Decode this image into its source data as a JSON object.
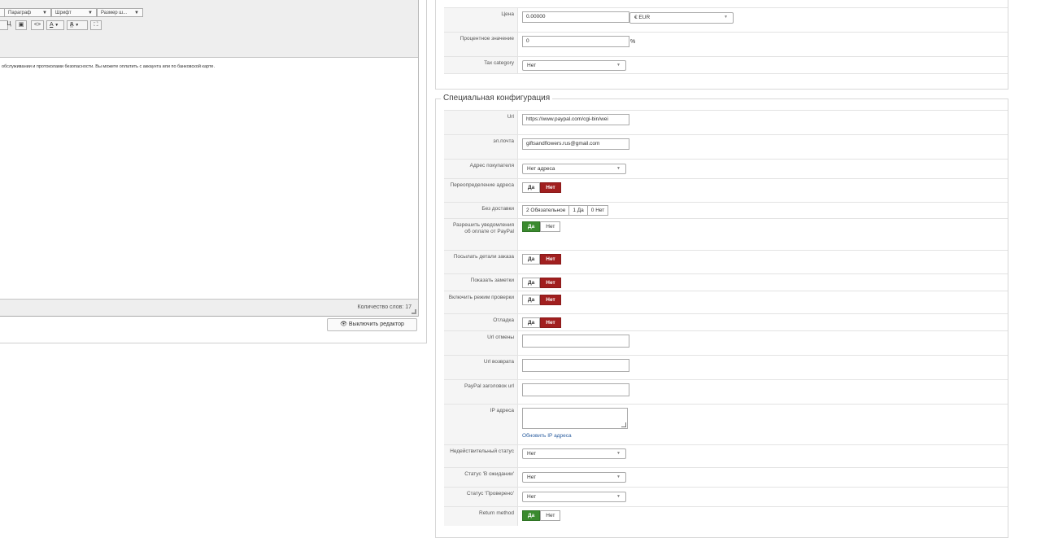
{
  "editor": {
    "toolbar_top_text": "...",
    "format_select": "Параграф",
    "font_select": "Шрифт",
    "size_select": "Размер ш...",
    "buttons": [
      "I",
      "Ц",
      "▣",
      "<>",
      "A",
      "A",
      "⛶"
    ],
    "content": "обслуживании и протоколами безопасности. Вы можете оплатить с аккаунта или по банковской карте.",
    "word_count": "Количество слов: 17",
    "toggle_editor_label": "👁 Выключить редактор"
  },
  "pricing": {
    "price_label": "Цена",
    "price_value": "0.00000",
    "currency_value": "€ EUR",
    "percent_label": "Процентное значение",
    "percent_value": "0",
    "percent_suffix": "%",
    "tax_label": "Tax category",
    "tax_value": "Нет"
  },
  "special": {
    "legend": "Специальная конфигурация",
    "url_label": "Url",
    "url_value": "https://www.paypal.com/cgi-bin/wei",
    "email_label": "эл.почта",
    "email_value": "giftsandflowers.rus@gmail.com",
    "buyer_address_label": "Адрес покупателя",
    "buyer_address_value": "Нет адреса",
    "override_address_label": "Переопределение адреса",
    "no_shipping_label": "Без доставки",
    "no_shipping_options": [
      "2 Обязательное",
      "1 Да",
      "0 Нет"
    ],
    "ipn_label": "Разрешить уведомления об оплате от PayPal",
    "send_details_label": "Посылать детали заказа",
    "show_notes_label": "Показать заметки",
    "test_mode_label": "Включить режим проверки",
    "debug_label": "Отладка",
    "cancel_url_label": "Url отмены",
    "return_url_label": "Url возврата",
    "header_url_label": "PayPal заголовок url",
    "ip_label": "IP адреса",
    "refresh_ip_link": "Обновить IP адреса",
    "invalid_status_label": "Недействительный статус",
    "invalid_status_value": "Нет",
    "pending_status_label": "Статус 'В ожидании'",
    "pending_status_value": "Нет",
    "verified_status_label": "Статус 'Проверено'",
    "verified_status_value": "Нет",
    "return_method_label": "Return method",
    "yes": "Да",
    "no": "Нет"
  },
  "colors": {
    "no_active": "#a11f1f",
    "yes_active": "#3a8a2e",
    "link": "#2a5d9f"
  }
}
